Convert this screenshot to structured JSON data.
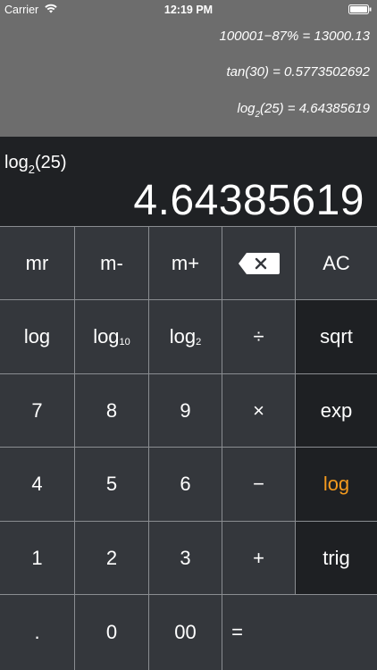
{
  "status": {
    "carrier": "Carrier",
    "time": "12:19 PM"
  },
  "history": {
    "line1": "100001−87% = 13000.13",
    "line2": "tan(30) = 0.5773502692",
    "line3_pre": "log",
    "line3_sub": "2",
    "line3_post": "(25) = 4.64385619"
  },
  "display": {
    "expr_pre": "log",
    "expr_sub": "2",
    "expr_post": "(25)",
    "result": "4.64385619"
  },
  "keys": {
    "mr": "mr",
    "m_minus": "m-",
    "m_plus": "m+",
    "ac": "AC",
    "log": "log",
    "log10_base": "log",
    "log10_sub": "10",
    "log2_base": "log",
    "log2_sub": "2",
    "divide": "÷",
    "sqrt": "sqrt",
    "seven": "7",
    "eight": "8",
    "nine": "9",
    "multiply": "×",
    "exp": "exp",
    "four": "4",
    "five": "5",
    "six": "6",
    "minus": "−",
    "log_mode": "log",
    "one": "1",
    "two": "2",
    "three": "3",
    "plus": "+",
    "trig": "trig",
    "dot": ".",
    "zero": "0",
    "double_zero": "00",
    "equals": "="
  },
  "colors": {
    "accent": "#f39a1e",
    "history_bg": "#6d6d6d",
    "display_bg": "#1f2124",
    "key_bg": "#34373c",
    "key_dark_bg": "#1e2023"
  },
  "icons": [
    "wifi-icon",
    "battery-icon",
    "backspace-icon"
  ]
}
